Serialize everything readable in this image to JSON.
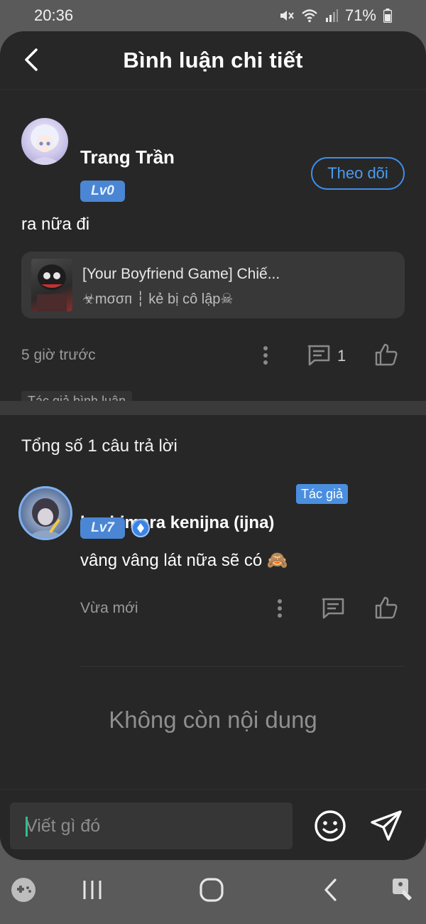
{
  "status_bar": {
    "time": "20:36",
    "battery": "71%",
    "icons": [
      "mute-icon",
      "wifi-icon",
      "signal-icon",
      "battery-icon"
    ]
  },
  "header": {
    "title": "Bình luận chi tiết",
    "back_icon": "chevron-left-icon"
  },
  "main_comment": {
    "user_name": "Trang Trần",
    "level": "Lv0",
    "follow_label": "Theo dõi",
    "text": "ra nữa đi",
    "linked_story": {
      "title": "[Your Boyfriend Game] Chiế...",
      "author": "☣mσσп ┆ kẻ bị cô lập☠"
    },
    "time": "5 giờ trước",
    "reply_count": "1",
    "author_tag": "Tác giả bình luận"
  },
  "replies": {
    "heading": "Tổng số 1 câu trả lời",
    "items": [
      {
        "user_name": "kochimara kenijna (ijna)",
        "author_chip": "Tác giả",
        "level": "Lv7",
        "text": "vâng vâng lát nữa sẽ có 🙈",
        "time": "Vừa mới"
      }
    ]
  },
  "no_more": "Không còn nội dung",
  "input": {
    "placeholder": "Viết gì đó",
    "value": ""
  },
  "colors": {
    "background": "#272727",
    "accent": "#4a9cf0",
    "level_badge": "#4a86d4",
    "muted_text": "#9a9a9a"
  }
}
